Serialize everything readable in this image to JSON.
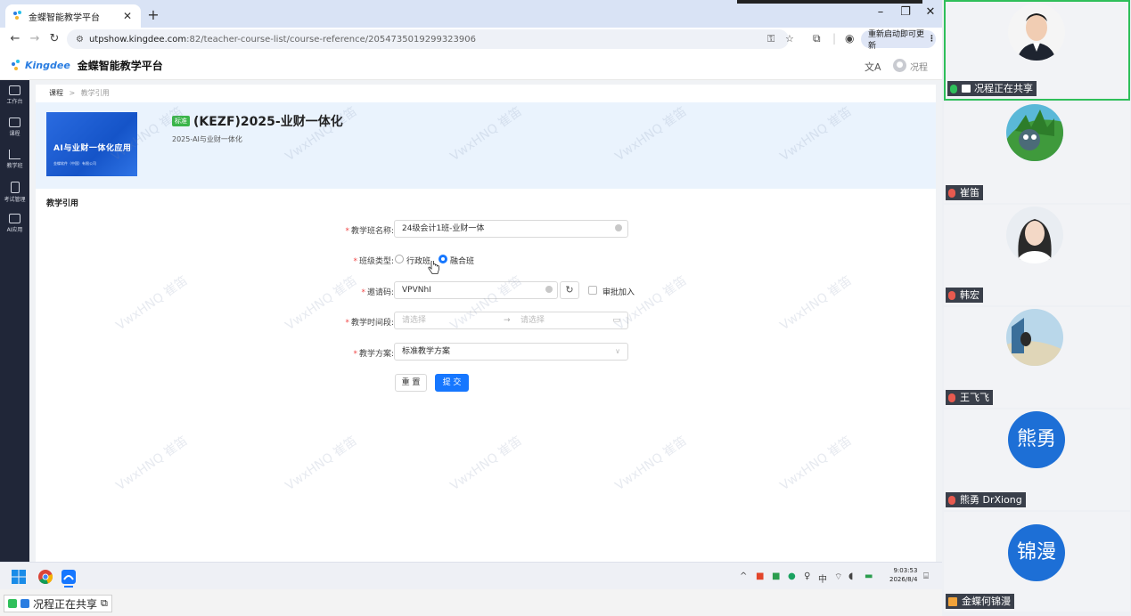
{
  "browser": {
    "tab_title": "金蝶智能教学平台",
    "url_host": "utpshow.kingdee.com",
    "url_path": ":82/teacher-course-list/course-reference/2054735019299323906",
    "relaunch_label": "重新启动即可更新"
  },
  "app": {
    "brand": "Kingdee",
    "platform_name": "金蝶智能教学平台",
    "user_name": "况程"
  },
  "sidebar": {
    "items": [
      {
        "label": "工作台",
        "icon": "monitor-icon"
      },
      {
        "label": "课程",
        "icon": "book-icon"
      },
      {
        "label": "教学班",
        "icon": "chart-icon"
      },
      {
        "label": "考试管理",
        "icon": "exam-icon"
      },
      {
        "label": "AI应用",
        "icon": "ai-monitor-icon"
      }
    ]
  },
  "breadcrumb": {
    "root": "课程",
    "separator": ">",
    "current": "教学引用"
  },
  "course": {
    "cover_title": "AI与业财一体化应用",
    "cover_subtitle": "金蝶软件（中国）有限公司",
    "badge": "标准",
    "title": "(KEZF)2025-业财一体化",
    "subtitle": "2025-AI与业财一体化"
  },
  "form": {
    "section_title": "教学引用",
    "required_mark": "*",
    "class_name_label": "教学班名称:",
    "class_name_value": "24级会计1班-业财一体",
    "class_type_label": "班级类型:",
    "class_type_options": [
      "行政班",
      "融合班"
    ],
    "class_type_selected": "融合班",
    "invite_code_label": "邀请码:",
    "invite_code_value": "VPVNhI",
    "approve_join_label": "审批加入",
    "period_label": "教学时间段:",
    "period_start_placeholder": "请选择",
    "period_sep": "→",
    "period_end_placeholder": "请选择",
    "plan_label": "教学方案:",
    "plan_value": "标准教学方案",
    "reset_label": "重 置",
    "submit_label": "提 交"
  },
  "watermark_text": "VwxHNQ 崔笛",
  "taskbar": {
    "time": "9:03:53",
    "date": "2026/8/4",
    "ime": "中"
  },
  "sharing_bar": {
    "label": "况程正在共享"
  },
  "participants": [
    {
      "name": "况程正在共享",
      "type": "photo",
      "sharing": true
    },
    {
      "name": "崔笛",
      "type": "photo"
    },
    {
      "name": "韩宏",
      "type": "photo"
    },
    {
      "name": "王飞飞",
      "type": "photo"
    },
    {
      "name": "熊勇 DrXiong",
      "type": "initial",
      "initial": "熊勇"
    },
    {
      "name": "金蝶何锦漫",
      "type": "initial",
      "initial": "锦漫"
    }
  ],
  "colors": {
    "primary": "#1677ff",
    "sidebar_bg": "#202638",
    "badge_green": "#3bb54a",
    "required_red": "#f04848",
    "active_speaker": "#2fbf5a",
    "avatar_blue": "#1d6fd6"
  }
}
